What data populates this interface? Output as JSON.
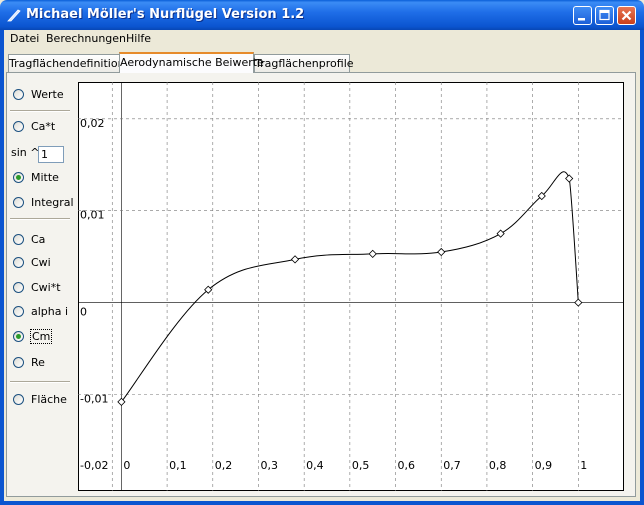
{
  "window": {
    "title": "Michael Möller's Nurflügel Version 1.2",
    "buttons": [
      "minimize",
      "maximize",
      "close"
    ]
  },
  "menu": [
    "Datei",
    "Berechnungen",
    "Hilfe"
  ],
  "tabs": [
    {
      "label": "Tragflächendefinition",
      "active": false
    },
    {
      "label": "Aerodynamische Beiwerte",
      "active": true
    },
    {
      "label": "Tragflächenprofile",
      "active": false
    }
  ],
  "options": {
    "werte": "Werte",
    "cat": "Ca*t",
    "sin_label": "sin ^",
    "sin_value": "1",
    "mitte": "Mitte",
    "integral": "Integral",
    "ca": "Ca",
    "cwi": "Cwi",
    "cwit": "Cwi*t",
    "alphai": "alpha i",
    "cm": "Cm",
    "re": "Re",
    "flaeche": "Fläche",
    "selected": [
      "Mitte",
      "Cm"
    ]
  },
  "chart_data": {
    "type": "line",
    "x_ticks": [
      "-0,02",
      "0",
      "0,1",
      "0,2",
      "0,3",
      "0,4",
      "0,5",
      "0,6",
      "0,7",
      "0,8",
      "0,9",
      "1"
    ],
    "y_ticks": [
      "0,02",
      "0,01",
      "0",
      "-0,01"
    ],
    "xlim": [
      -0.095,
      1.1
    ],
    "ylim": [
      -0.0205,
      0.024
    ],
    "grid": true,
    "series": [
      {
        "x": [
          0,
          0.19,
          0.38,
          0.55,
          0.7,
          0.83,
          0.92,
          0.98,
          1.0
        ],
        "y": [
          -0.0108,
          0.0014,
          0.0047,
          0.0053,
          0.0055,
          0.0075,
          0.0116,
          0.0135,
          0.0
        ],
        "color": "#000000"
      }
    ]
  }
}
